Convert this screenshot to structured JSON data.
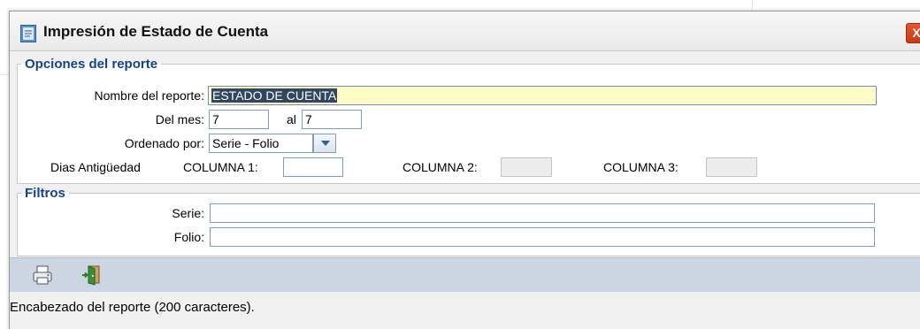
{
  "window": {
    "title": "Impresión de Estado de Cuenta",
    "close_glyph": "X",
    "title_icon": "report-window-icon",
    "close_color": "#d6471f"
  },
  "opciones": {
    "legend": "Opciones del reporte",
    "nombre_label": "Nombre del reporte:",
    "nombre_value": "ESTADO DE CUENTA",
    "del_mes_label": "Del mes:",
    "del_mes_value": "7",
    "al_label": "al",
    "al_value": "7",
    "ordenado_label": "Ordenado por:",
    "ordenado_value": "Serie - Folio",
    "dias_label": "Dias Antigüedad",
    "col1_label": "COLUMNA 1:",
    "col1_value": "",
    "col2_label": "COLUMNA 2:",
    "col2_value": "",
    "col3_label": "COLUMNA 3:",
    "col3_value": ""
  },
  "filtros": {
    "legend": "Filtros",
    "serie_label": "Serie:",
    "serie_value": "",
    "folio_label": "Folio:",
    "folio_value": ""
  },
  "toolbar": {
    "print_icon": "printer-icon",
    "exit_icon": "exit-door-icon"
  },
  "status": {
    "text": "Encabezado del reporte (200 caracteres)."
  },
  "colors": {
    "legend": "#15428b",
    "toolbar_bg": "#ccd6e2",
    "highlight_field": "#fefdc8"
  }
}
